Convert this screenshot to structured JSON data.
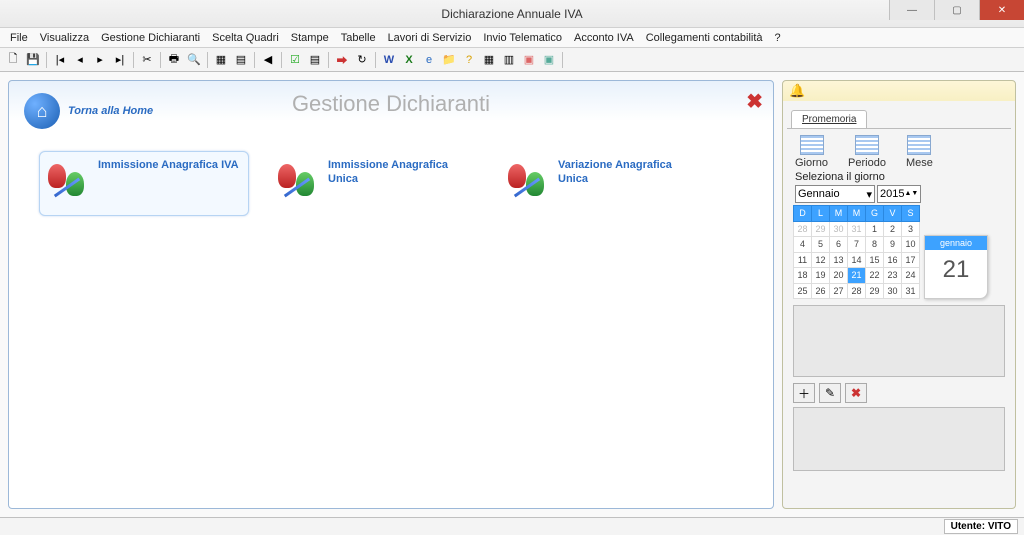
{
  "window": {
    "title": "Dichiarazione Annuale IVA"
  },
  "menu": [
    "File",
    "Visualizza",
    "Gestione Dichiaranti",
    "Scelta Quadri",
    "Stampe",
    "Tabelle",
    "Lavori di Servizio",
    "Invio Telematico",
    "Acconto IVA",
    "Collegamenti contabilità",
    "?"
  ],
  "page": {
    "home_link": "Torna alla Home",
    "title": "Gestione Dichiaranti"
  },
  "cards": [
    {
      "label": "Immissione Anagrafica IVA",
      "selected": true
    },
    {
      "label": "Immissione Anagrafica Unica",
      "selected": false
    },
    {
      "label": "Variazione Anagrafica Unica",
      "selected": false
    }
  ],
  "promemoria": {
    "tab": "Promemoria",
    "modes": {
      "day": "Giorno",
      "period": "Periodo",
      "month": "Mese"
    },
    "select_label": "Seleziona il giorno",
    "month": "Gennaio",
    "year": "2015",
    "weekdays": [
      "D",
      "L",
      "M",
      "M",
      "G",
      "V",
      "S"
    ],
    "weeks": [
      [
        {
          "n": "28",
          "dim": true
        },
        {
          "n": "29",
          "dim": true
        },
        {
          "n": "30",
          "dim": true
        },
        {
          "n": "31",
          "dim": true
        },
        {
          "n": "1"
        },
        {
          "n": "2"
        },
        {
          "n": "3"
        }
      ],
      [
        {
          "n": "4"
        },
        {
          "n": "5"
        },
        {
          "n": "6"
        },
        {
          "n": "7"
        },
        {
          "n": "8"
        },
        {
          "n": "9"
        },
        {
          "n": "10"
        }
      ],
      [
        {
          "n": "11"
        },
        {
          "n": "12"
        },
        {
          "n": "13"
        },
        {
          "n": "14"
        },
        {
          "n": "15"
        },
        {
          "n": "16"
        },
        {
          "n": "17"
        }
      ],
      [
        {
          "n": "18"
        },
        {
          "n": "19"
        },
        {
          "n": "20"
        },
        {
          "n": "21",
          "today": true
        },
        {
          "n": "22"
        },
        {
          "n": "23"
        },
        {
          "n": "24"
        }
      ],
      [
        {
          "n": "25"
        },
        {
          "n": "26"
        },
        {
          "n": "27"
        },
        {
          "n": "28"
        },
        {
          "n": "29"
        },
        {
          "n": "30"
        },
        {
          "n": "31"
        }
      ]
    ],
    "big_day": {
      "month": "gennaio",
      "num": "21"
    }
  },
  "status": {
    "user_label": "Utente: VITO"
  }
}
